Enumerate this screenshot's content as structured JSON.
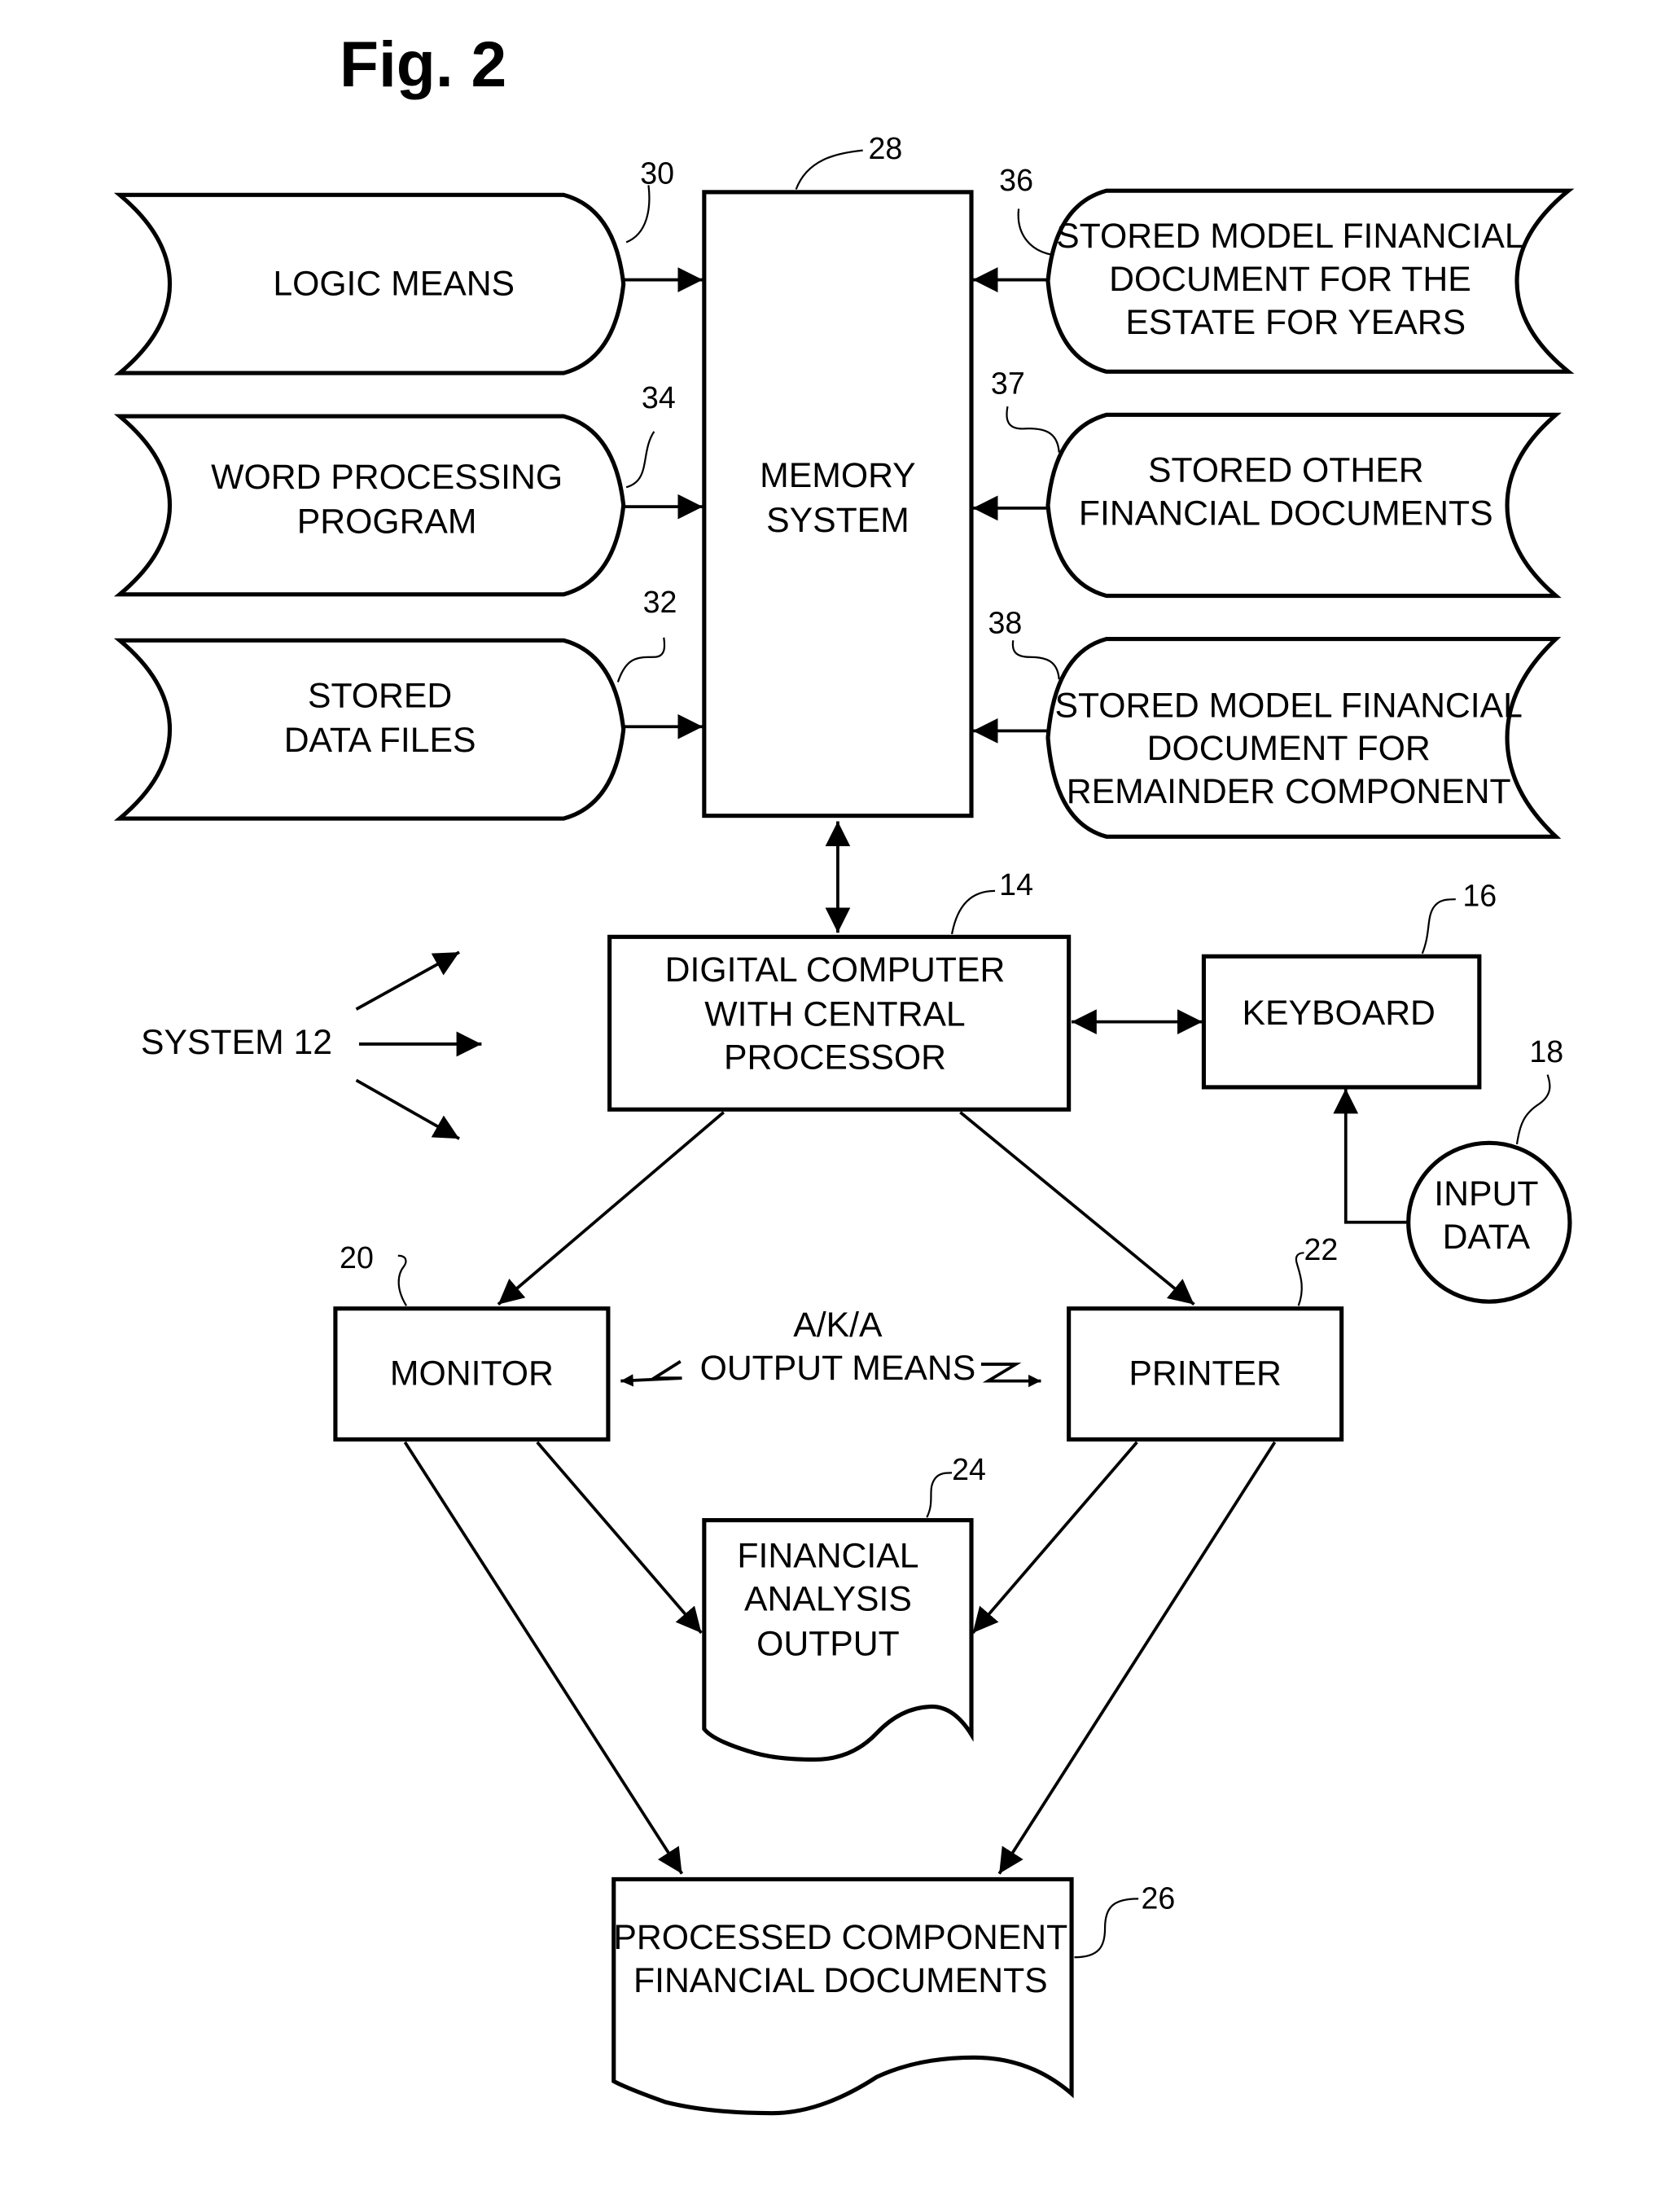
{
  "figure": {
    "title": "Fig. 2"
  },
  "nodes": {
    "memory": {
      "ref": "28",
      "lines": [
        "MEMORY",
        "SYSTEM"
      ]
    },
    "logic": {
      "ref": "30",
      "lines": [
        "LOGIC MEANS"
      ]
    },
    "word_processing": {
      "ref": "34",
      "lines": [
        "WORD PROCESSING",
        "PROGRAM"
      ]
    },
    "data_files": {
      "ref": "32",
      "lines": [
        "STORED",
        "DATA FILES"
      ]
    },
    "model_estate": {
      "ref": "36",
      "lines": [
        "STORED MODEL FINANCIAL",
        "DOCUMENT FOR THE",
        "ESTATE FOR YEARS"
      ]
    },
    "other_docs": {
      "ref": "37",
      "lines": [
        "STORED OTHER",
        "FINANCIAL DOCUMENTS"
      ]
    },
    "model_remainder": {
      "ref": "38",
      "lines": [
        "STORED MODEL FINANCIAL",
        "DOCUMENT FOR",
        "REMAINDER COMPONENT"
      ]
    },
    "computer": {
      "ref": "14",
      "lines": [
        "DIGITAL COMPUTER",
        "WITH CENTRAL",
        "PROCESSOR"
      ]
    },
    "keyboard": {
      "ref": "16",
      "lines": [
        "KEYBOARD"
      ]
    },
    "input_data": {
      "ref": "18",
      "lines": [
        "INPUT",
        "DATA"
      ]
    },
    "system": {
      "lines": [
        "SYSTEM 12"
      ]
    },
    "monitor": {
      "ref": "20",
      "lines": [
        "MONITOR"
      ]
    },
    "printer": {
      "ref": "22",
      "lines": [
        "PRINTER"
      ]
    },
    "output_means": {
      "lines": [
        "A/K/A",
        "OUTPUT MEANS"
      ]
    },
    "analysis_output": {
      "ref": "24",
      "lines": [
        "FINANCIAL",
        "ANALYSIS",
        "OUTPUT"
      ]
    },
    "processed_docs": {
      "ref": "26",
      "lines": [
        "PROCESSED COMPONENT",
        "FINANCIAL DOCUMENTS"
      ]
    }
  }
}
